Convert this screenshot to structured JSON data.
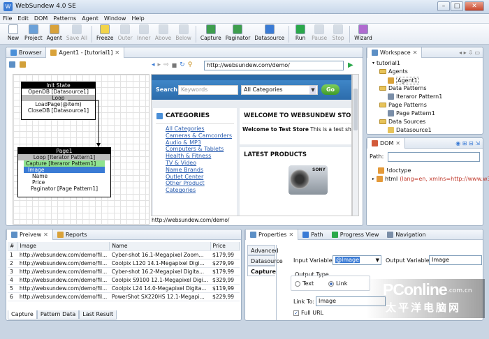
{
  "app": {
    "title": "WebSundew 4.0 SE"
  },
  "menu": [
    "File",
    "Edit",
    "DOM",
    "Patterns",
    "Agent",
    "Window",
    "Help"
  ],
  "toolbar": [
    {
      "label": "New",
      "color": "#ffffff",
      "group": 1
    },
    {
      "label": "Project",
      "color": "#6aa0d8",
      "group": 1
    },
    {
      "label": "Agent",
      "color": "#d9a23a",
      "group": 1
    },
    {
      "label": "Save All",
      "color": "#8aa0b8",
      "group": 1,
      "disabled": true
    },
    {
      "label": "Freeze",
      "color": "#f2d44a",
      "group": 2
    },
    {
      "label": "Outer",
      "color": "#9ab",
      "group": 2,
      "disabled": true
    },
    {
      "label": "Inner",
      "color": "#9ab",
      "group": 2,
      "disabled": true
    },
    {
      "label": "Above",
      "color": "#9ab",
      "group": 2,
      "disabled": true
    },
    {
      "label": "Below",
      "color": "#9ab",
      "group": 2,
      "disabled": true
    },
    {
      "label": "Capture",
      "color": "#3e9e4e",
      "group": 3
    },
    {
      "label": "Paginator",
      "color": "#3e9e4e",
      "group": 3
    },
    {
      "label": "Datasource",
      "color": "#3a7bd5",
      "group": 3
    },
    {
      "label": "Run",
      "color": "#2aa84a",
      "group": 4
    },
    {
      "label": "Pause",
      "color": "#9ab",
      "group": 4,
      "disabled": true
    },
    {
      "label": "Stop",
      "color": "#9ab",
      "group": 4,
      "disabled": true
    },
    {
      "label": "Wizard",
      "color": "#b06ad0",
      "group": 5
    }
  ],
  "editor": {
    "tabs": [
      "Browser",
      "Agent1 - [tutorial1]"
    ],
    "url": "http://websundew.com/demo/",
    "status_url": "http://websundew.com/demo/"
  },
  "diagram": {
    "init_title": "Init State",
    "init_items": [
      "OpenDB [Datasource1]"
    ],
    "loop_label": "Loop",
    "loop_items": [
      "LoadPage(@item)",
      "CloseDB [Datasource1]"
    ],
    "page_title": "Page1",
    "page_loop": "Loop [Iterator Pattern1]",
    "page_items": [
      "Capture [Iteraror Pattern1]",
      "Image",
      "Name",
      "Price"
    ],
    "paginator": "Paginator [Page Pattern1]"
  },
  "web": {
    "search_label": "Search:",
    "search_placeholder": "Keywords",
    "category_select": "All Categories",
    "go": "Go",
    "categories_title": "CATEGORIES",
    "categories": [
      "All Categories",
      "Cameras & Camcorders",
      "Audio & MP3",
      "Computers & Tablets",
      "Health & Fitness",
      "TV & Video",
      "Name Brands",
      "Outlet Center",
      "Other Product",
      "Categories"
    ],
    "welcome_title": "WELCOME TO WEBSUNDEW STORE",
    "welcome_bold": "Welcome to Test Store",
    "welcome_text": " This is a test shop",
    "latest_title": "LATEST PRODUCTS",
    "camera_brand": "SONY"
  },
  "workspace": {
    "tab": "Workspace",
    "root": "tutorial1",
    "agents": "Agents",
    "agent1": "Agent1",
    "data_patterns": "Data Patterns",
    "iter_pattern": "Iteraror Pattern1",
    "page_patterns": "Page Patterns",
    "page_pattern": "Page Pattern1",
    "data_sources": "Data Sources",
    "datasource": "Datasource1"
  },
  "dom": {
    "tab": "DOM",
    "path_label": "Path:",
    "doctype": "!doctype",
    "html_tag": "html",
    "html_attrs": "(lang=en, xmlns=http://www.w3..."
  },
  "preview": {
    "tabs": [
      "Preivew",
      "Reports"
    ],
    "columns": [
      "#",
      "Image",
      "Name",
      "Price"
    ],
    "rows": [
      [
        "1",
        "http://websundew.com/demo/fil...",
        "Cyber-shot 16.1-Megapixel Zoom...",
        "$179,99"
      ],
      [
        "2",
        "http://websundew.com/demo/fil...",
        "Coolpix L120 14.1-Megapixel Digi...",
        "$279,99"
      ],
      [
        "3",
        "http://websundew.com/demo/fil...",
        "Cyber-shot 16.2-Megapixel Digita...",
        "$179,99"
      ],
      [
        "4",
        "http://websundew.com/demo/fil...",
        "Coolpix S9100 12.1-Megapixel Digi...",
        "$329,99"
      ],
      [
        "5",
        "http://websundew.com/demo/fil...",
        "Coolpix L24 14.0-Megapixel Digita...",
        "$119,99"
      ],
      [
        "6",
        "http://websundew.com/demo/fil...",
        "PowerShot SX220HS 12.1-Megapi...",
        "$229,99"
      ]
    ],
    "bottom_tabs": [
      "Capture",
      "Pattern Data",
      "Last Result"
    ]
  },
  "properties": {
    "tabs": [
      "Properties",
      "Path",
      "Progress View",
      "Navigation"
    ],
    "side_tabs": [
      "Advanced",
      "Datasource",
      "Capture"
    ],
    "input_var_label": "Input Variable:",
    "input_var_value": "@Image",
    "output_var_label": "Output Variable:",
    "output_var_value": "Image",
    "output_type_label": "Output Type",
    "radio_text": "Text",
    "radio_link": "Link",
    "link_to_label": "Link To:",
    "link_to_value": "Image",
    "full_url_label": "Full URL"
  },
  "watermark": {
    "brand": "PConline",
    "suffix": ".com.cn",
    "chinese": "太平洋电脑网"
  }
}
